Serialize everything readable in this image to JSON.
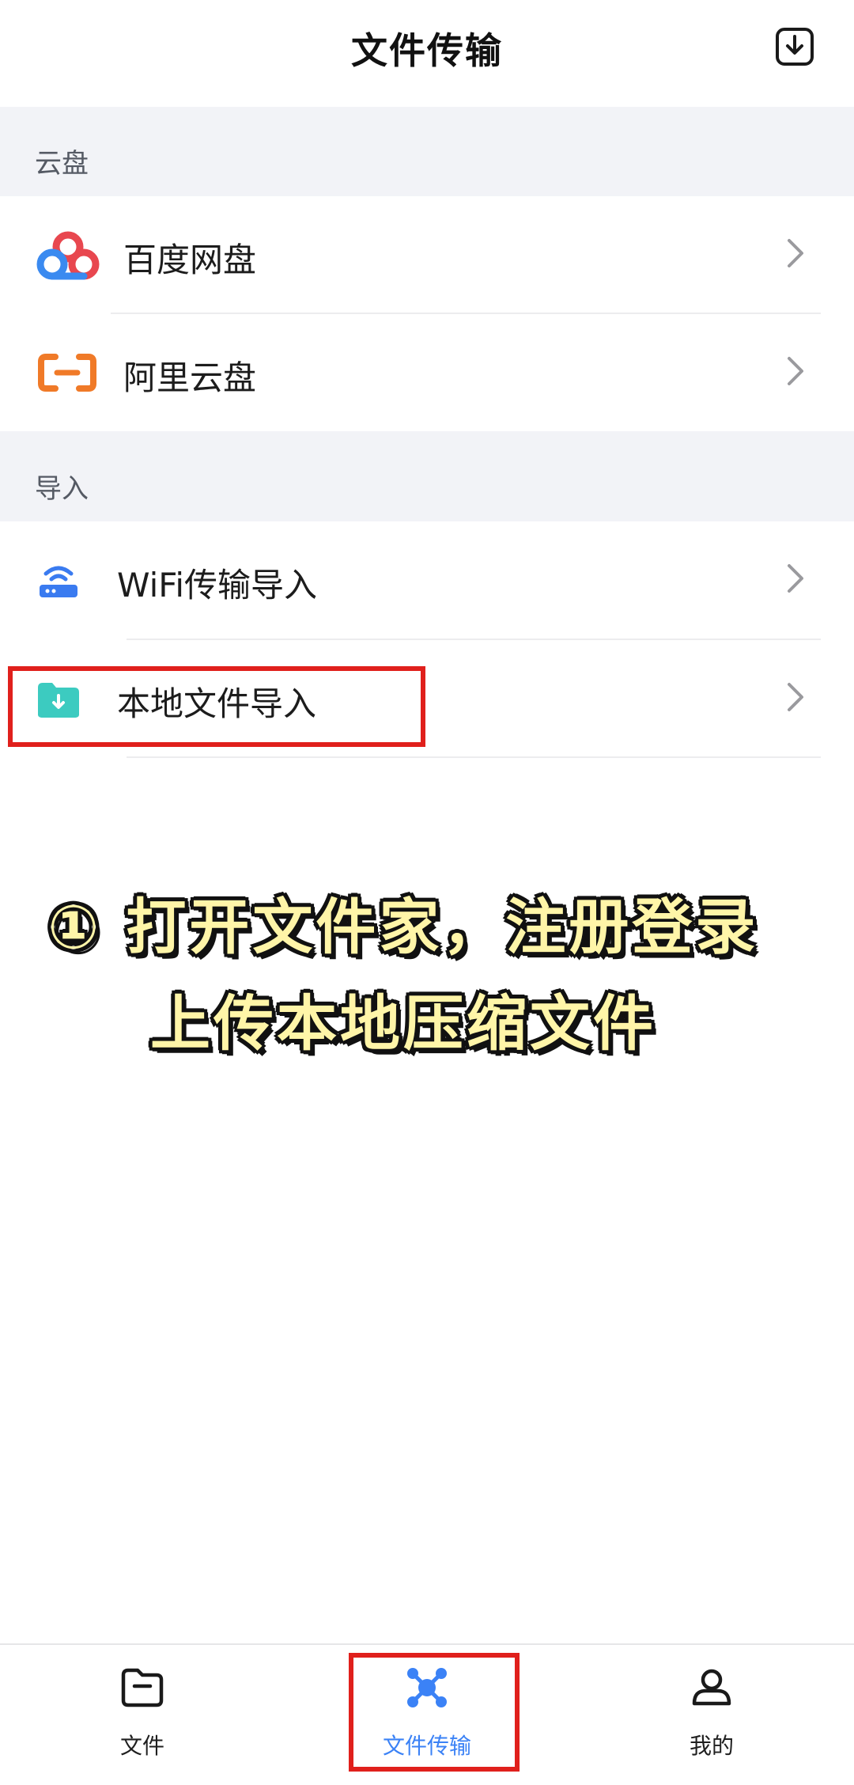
{
  "header": {
    "title": "文件传输",
    "download_icon": "download-box-icon"
  },
  "sections": [
    {
      "title": "云盘",
      "items": [
        {
          "label": "百度网盘",
          "icon": "baidu-netdisk-icon"
        },
        {
          "label": "阿里云盘",
          "icon": "aliyun-drive-icon"
        }
      ]
    },
    {
      "title": "导入",
      "items": [
        {
          "label": "WiFi传输导入",
          "icon": "wifi-router-icon"
        },
        {
          "label": "本地文件导入",
          "icon": "folder-download-icon"
        }
      ]
    }
  ],
  "overlay": {
    "line1": "① 打开文件家，注册登录",
    "line2": "上传本地压缩文件"
  },
  "tabbar": [
    {
      "label": "文件",
      "icon": "folder-icon",
      "active": false
    },
    {
      "label": "文件传输",
      "icon": "transfer-nodes-icon",
      "active": true
    },
    {
      "label": "我的",
      "icon": "person-icon",
      "active": false
    }
  ],
  "colors": {
    "accent": "#3b82f6",
    "highlight": "#e0201c",
    "section_bg": "#f2f3f7",
    "overlay_text": "#fff5a8"
  }
}
